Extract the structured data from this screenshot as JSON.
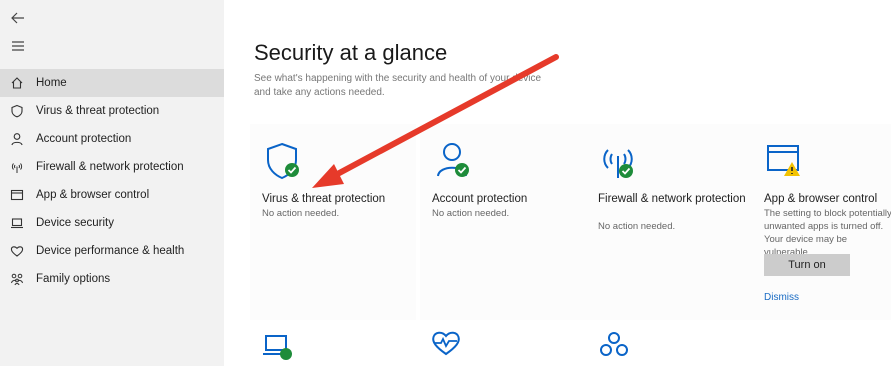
{
  "sidebar": {
    "items": [
      {
        "label": "Home",
        "icon": "home-icon",
        "selected": true
      },
      {
        "label": "Virus & threat protection",
        "icon": "shield-icon"
      },
      {
        "label": "Account protection",
        "icon": "person-icon"
      },
      {
        "label": "Firewall & network protection",
        "icon": "wifi-signal-icon"
      },
      {
        "label": "App & browser control",
        "icon": "browser-window-icon"
      },
      {
        "label": "Device security",
        "icon": "device-icon"
      },
      {
        "label": "Device performance & health",
        "icon": "heart-icon"
      },
      {
        "label": "Family options",
        "icon": "family-icon"
      }
    ]
  },
  "main": {
    "title": "Security at a glance",
    "subtitle": "See what's happening with the security and health of your device and take any actions needed.",
    "tiles": [
      {
        "title": "Virus & threat protection",
        "desc": "No action needed.",
        "icon": "shield-check-icon"
      },
      {
        "title": "Account protection",
        "desc": "No action needed.",
        "icon": "person-check-icon"
      },
      {
        "title": "Firewall & network protection",
        "desc": "No action needed.",
        "icon": "antenna-check-icon"
      },
      {
        "title": "App & browser control",
        "desc": "The setting to block potentially unwanted apps is turned off. Your device may be vulnerable.",
        "icon": "browser-warning-icon",
        "button": "Turn on",
        "link": "Dismiss"
      }
    ]
  },
  "colors": {
    "accent_blue": "#0a64c8",
    "ok_green": "#1e8c3a",
    "warning_yellow": "#f2c200",
    "arrow_red": "#e63a2a"
  }
}
